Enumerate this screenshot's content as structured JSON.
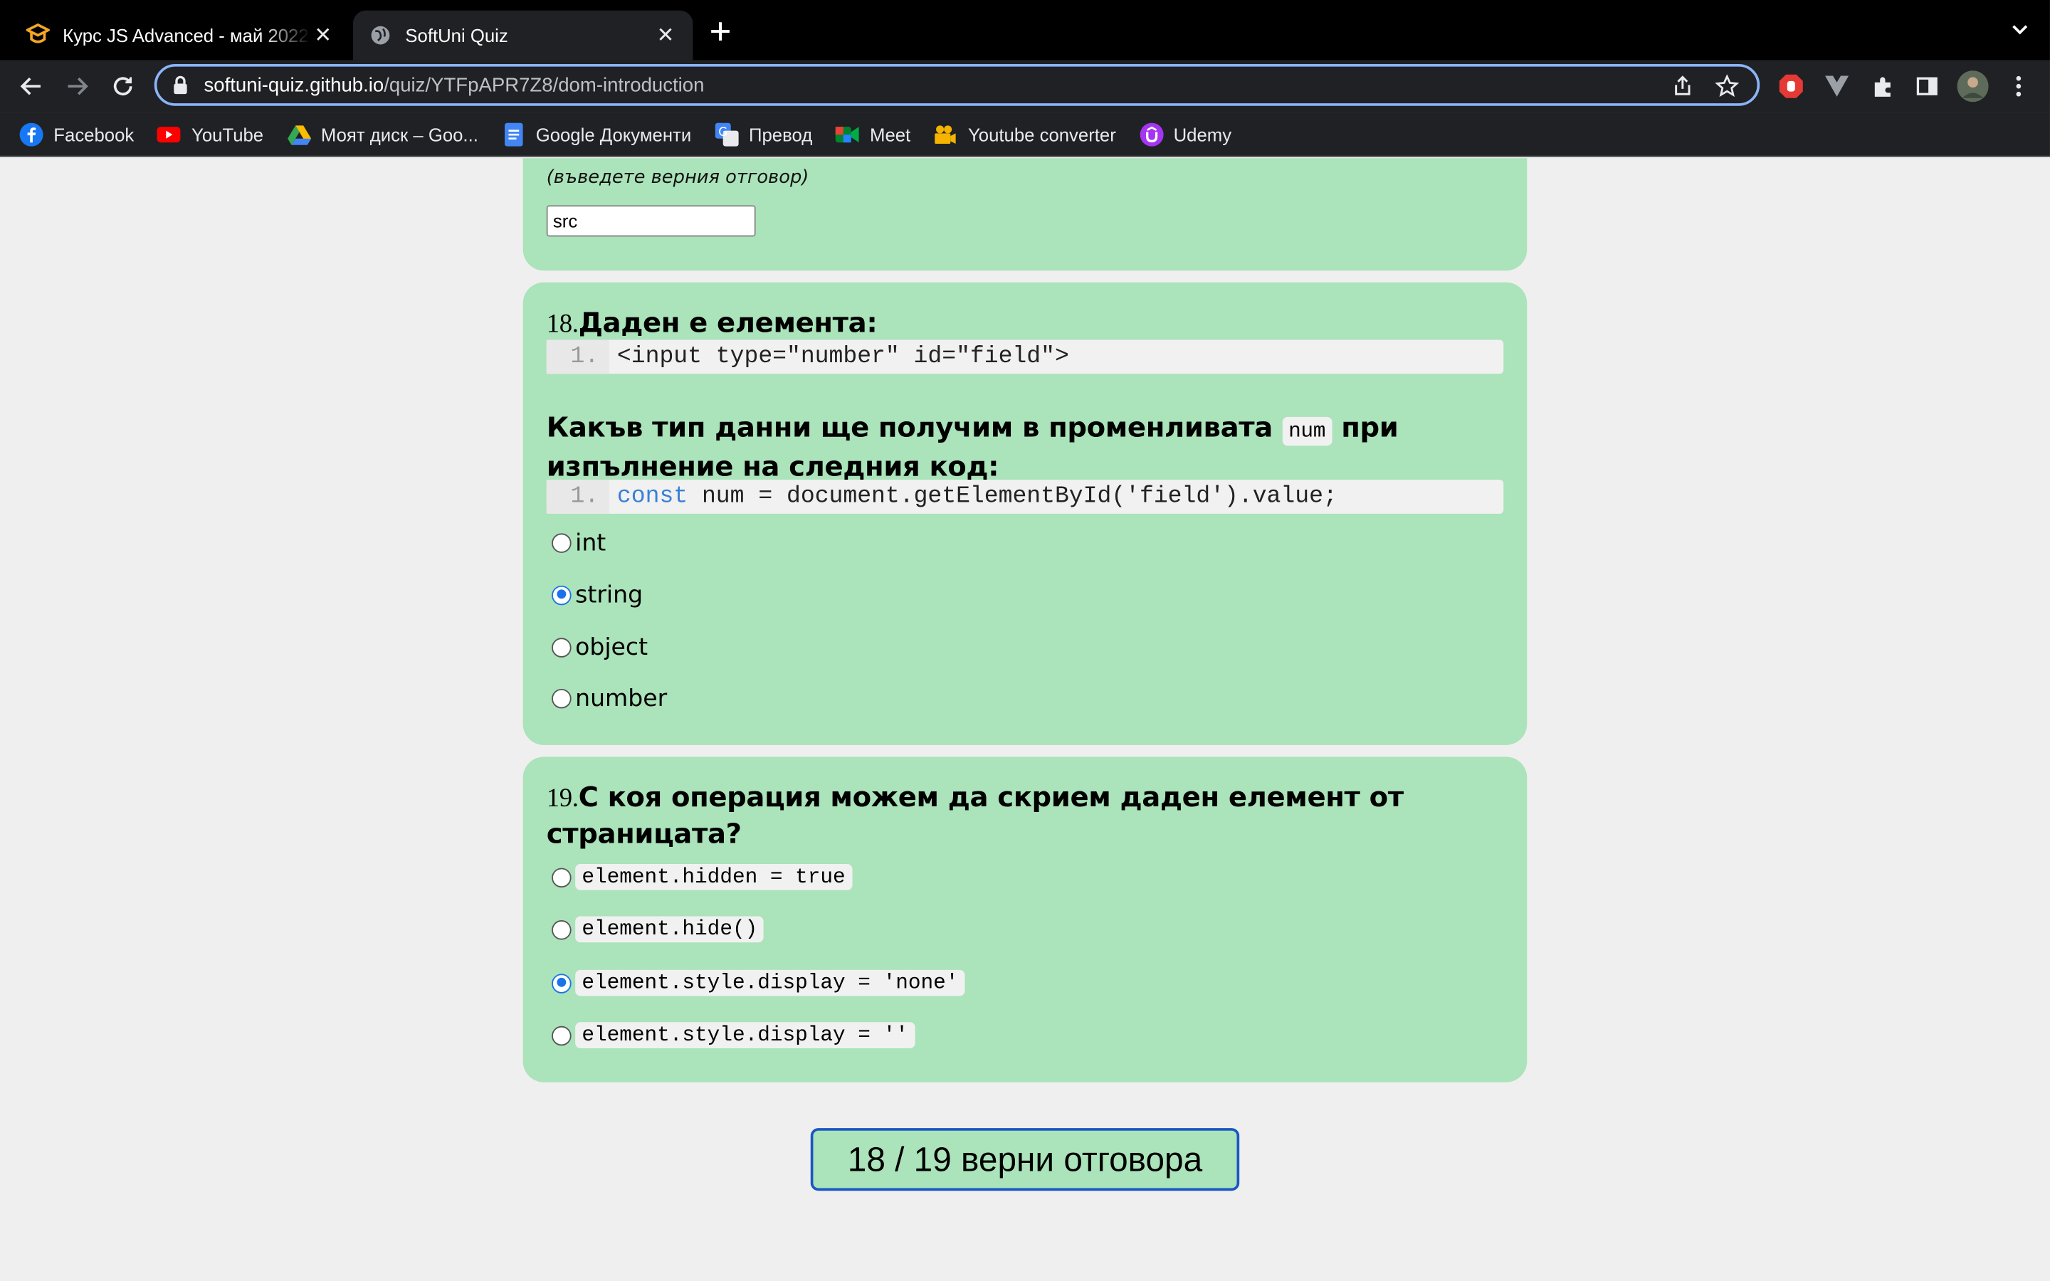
{
  "browser": {
    "tabs": [
      {
        "title": "Курс JS Advanced - май 2022",
        "icon": "softuni-logo-icon",
        "active": false
      },
      {
        "title": "SoftUni Quiz",
        "icon": "globe-icon",
        "active": true
      }
    ],
    "url_host": "softuni-quiz.github.io",
    "url_path": "/quiz/YTFpAPR7Z8/dom-introduction",
    "bookmarks": [
      {
        "label": "Facebook",
        "icon": "facebook-icon"
      },
      {
        "label": "YouTube",
        "icon": "youtube-icon"
      },
      {
        "label": "Моят диск – Goo...",
        "icon": "google-drive-icon"
      },
      {
        "label": "Google Документи",
        "icon": "google-docs-icon"
      },
      {
        "label": "Превод",
        "icon": "google-translate-icon"
      },
      {
        "label": "Meet",
        "icon": "google-meet-icon"
      },
      {
        "label": "Youtube converter",
        "icon": "video-camera-icon"
      },
      {
        "label": "Udemy",
        "icon": "udemy-icon"
      }
    ]
  },
  "quiz": {
    "q17": {
      "hint": "(въведете верния отговор)",
      "answer": "src"
    },
    "q18": {
      "number": "18.",
      "title": "Даден е елемента:",
      "code1_line": "1.",
      "code1": "<input type=\"number\" id=\"field\">",
      "question_part1": "Какъв тип данни ще получим в променливата",
      "question_code": "num",
      "question_part2": "при изпълнение на следния код:",
      "code2_line": "1.",
      "code2_keyword": "const",
      "code2_rest": " num = document.getElementById('field').value;",
      "options": [
        "int",
        "string",
        "object",
        "number"
      ],
      "selected_index": 1
    },
    "q19": {
      "number": "19.",
      "title": "С коя операция можем да скрием даден елемент от страницата?",
      "options": [
        "element.hidden = true",
        "element.hide()",
        "element.style.display = 'none'",
        "element.style.display = ''"
      ],
      "selected_index": 2
    },
    "score": "18 / 19 верни отговора"
  }
}
